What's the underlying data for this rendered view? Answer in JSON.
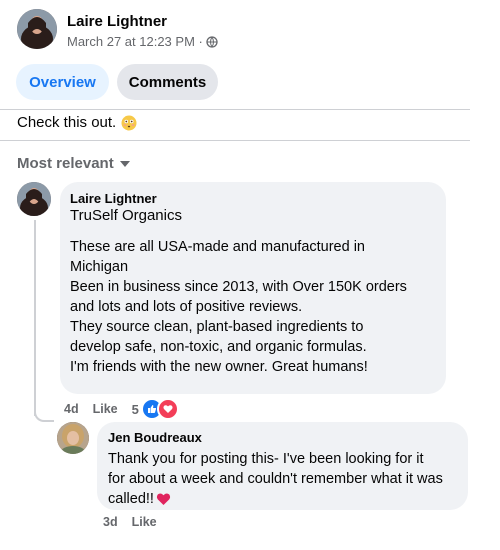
{
  "post": {
    "author": "Laire Lightner",
    "timestamp": "March 27 at 12:23 PM ·",
    "text": "Check this out."
  },
  "tabs": [
    {
      "label": "Overview",
      "active": true
    },
    {
      "label": "Comments",
      "active": false
    }
  ],
  "sort": {
    "label": "Most relevant"
  },
  "comments": [
    {
      "author": "Laire Lightner",
      "subtitle": "TruSelf Organics",
      "lines": [
        "These are all USA-made and manufactured in",
        "Michigan",
        "Been in business since 2013, with Over 150K orders",
        "and lots and lots of positive reviews.",
        "They source clean, plant-based ingredients to",
        "develop safe, non-toxic, and organic formulas.",
        "I'm friends with the new owner. Great humans!"
      ],
      "age": "4d",
      "like_label": "Like",
      "reaction_count": "5"
    },
    {
      "author": "Jen Boudreaux",
      "lines": [
        "Thank you for posting this- I've been looking for it",
        "for about a week and couldn't remember what it was",
        "called!!"
      ],
      "age": "3d",
      "like_label": "Like"
    }
  ],
  "colors": {
    "accent": "#1877f2",
    "love": "#f33e58",
    "bubble": "#f0f2f5"
  }
}
